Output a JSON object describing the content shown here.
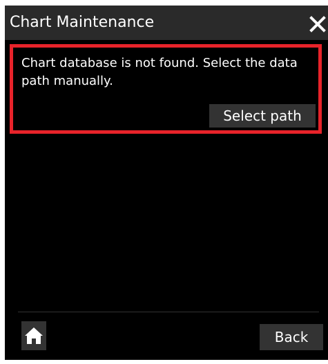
{
  "dialog": {
    "title": "Chart Maintenance",
    "close_icon": "close-icon"
  },
  "notice": {
    "message": "Chart database is not found. Select the data path manually.",
    "select_path_label": "Select path",
    "border_color": "#e8232a"
  },
  "footer": {
    "home_icon": "home-icon",
    "back_label": "Back"
  }
}
